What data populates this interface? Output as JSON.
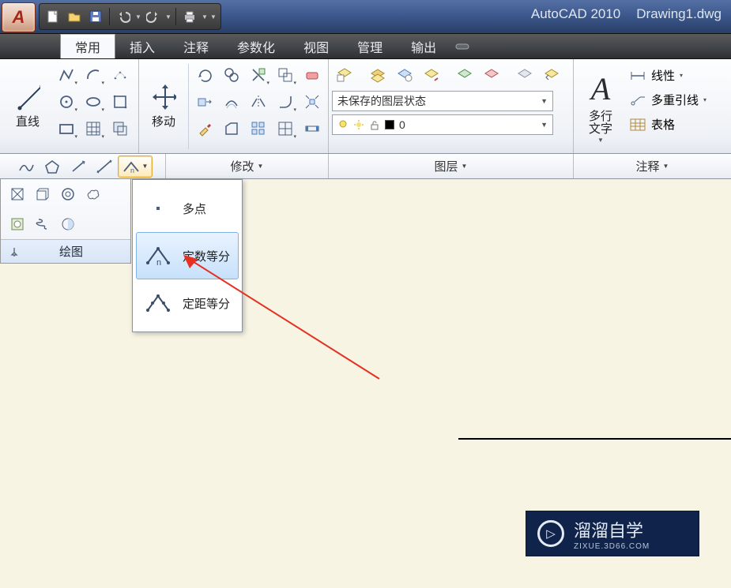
{
  "app": {
    "title": "AutoCAD 2010",
    "document": "Drawing1.dwg",
    "app_glyph": "A"
  },
  "tabs": {
    "t0": "常用",
    "t1": "插入",
    "t2": "注释",
    "t3": "参数化",
    "t4": "视图",
    "t5": "管理",
    "t6": "输出"
  },
  "draw_panel": {
    "line_label": "直线",
    "caption": "绘图"
  },
  "modify_panel": {
    "move_label": "移动",
    "title": "修改"
  },
  "layer_panel": {
    "unsaved_state": "未保存的图层状态",
    "current_layer": "0",
    "title": "图层"
  },
  "annot_panel": {
    "mtext_label": "多行\n文字",
    "linear": "线性",
    "mleader": "多重引线",
    "table": "表格",
    "title": "注释"
  },
  "dropdown": {
    "multi_point": "多点",
    "divide": "定数等分",
    "measure": "定距等分"
  },
  "watermark": {
    "main": "溜溜自学",
    "sub": "ZIXUE.3D66.COM"
  }
}
